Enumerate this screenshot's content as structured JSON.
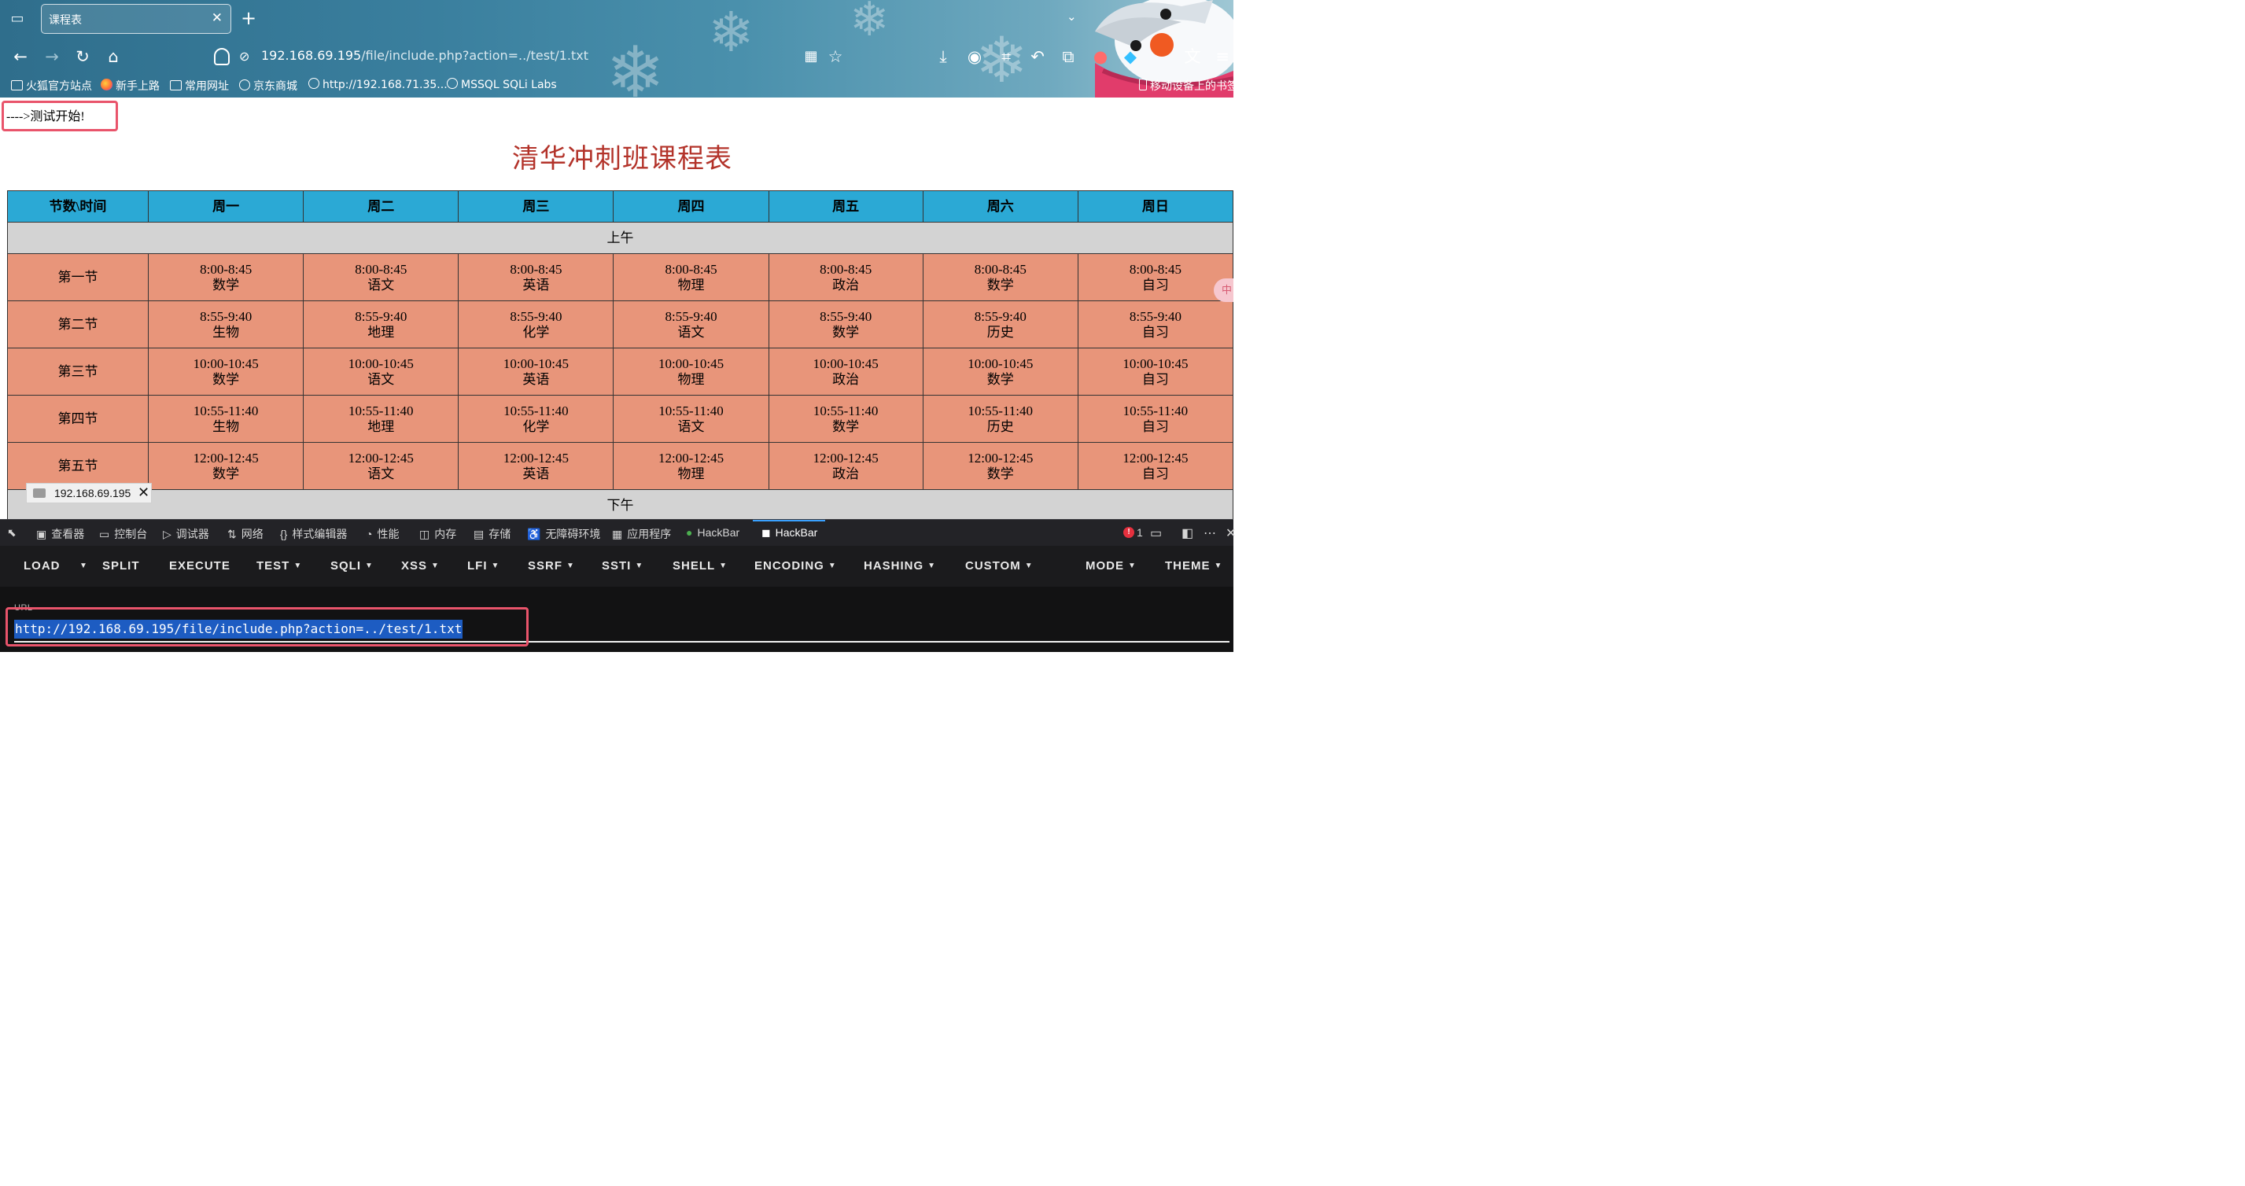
{
  "browser": {
    "tab_title": "课程表",
    "url_host": "192.168.69.195",
    "url_path": "/file/include.php?action=../test/1.txt",
    "bookmarks": [
      "火狐官方站点",
      "新手上路",
      "常用网址",
      "京东商城",
      "http://192.168.71.35...",
      "MSSQL SQLi Labs"
    ],
    "mobile_bookmarks": "移动设备上的书签"
  },
  "page": {
    "test_start": "---->测试开始!",
    "title": "清华冲刺班课程表",
    "header": [
      "节数\\时间",
      "周一",
      "周二",
      "周三",
      "周四",
      "周五",
      "周六",
      "周日"
    ],
    "morning_label": "上午",
    "afternoon_label": "下午",
    "rows": [
      {
        "name": "第一节",
        "time": "8:00-8:45",
        "subjects": [
          "数学",
          "语文",
          "英语",
          "物理",
          "政治",
          "数学",
          "自习"
        ]
      },
      {
        "name": "第二节",
        "time": "8:55-9:40",
        "subjects": [
          "生物",
          "地理",
          "化学",
          "语文",
          "数学",
          "历史",
          "自习"
        ]
      },
      {
        "name": "第三节",
        "time": "10:00-10:45",
        "subjects": [
          "数学",
          "语文",
          "英语",
          "物理",
          "政治",
          "数学",
          "自习"
        ]
      },
      {
        "name": "第四节",
        "time": "10:55-11:40",
        "subjects": [
          "生物",
          "地理",
          "化学",
          "语文",
          "数学",
          "历史",
          "自习"
        ]
      },
      {
        "name": "第五节",
        "time": "12:00-12:45",
        "subjects": [
          "数学",
          "语文",
          "英语",
          "物理",
          "政治",
          "数学",
          "自习"
        ]
      }
    ],
    "download_chip": "192.168.69.195",
    "side_pill": "中"
  },
  "devtools": {
    "tabs": [
      "查看器",
      "控制台",
      "调试器",
      "网络",
      "样式编辑器",
      "性能",
      "内存",
      "存储",
      "无障碍环境",
      "应用程序",
      "HackBar",
      "HackBar"
    ],
    "error_count": "1"
  },
  "hackbar": {
    "buttons": [
      "LOAD",
      "SPLIT",
      "EXECUTE",
      "TEST",
      "SQLI",
      "XSS",
      "LFI",
      "SSRF",
      "SSTI",
      "SHELL",
      "ENCODING",
      "HASHING",
      "CUSTOM",
      "MODE",
      "THEME"
    ],
    "url_label": "URL",
    "url_value": "http://192.168.69.195/file/include.php?action=../test/1.txt"
  },
  "colors": {
    "header_bg": "#2ba9d5",
    "lesson_bg": "#e8957a",
    "period_bg": "#d3d3d3",
    "title_color": "#b3332a",
    "highlight": "#e9546b"
  }
}
